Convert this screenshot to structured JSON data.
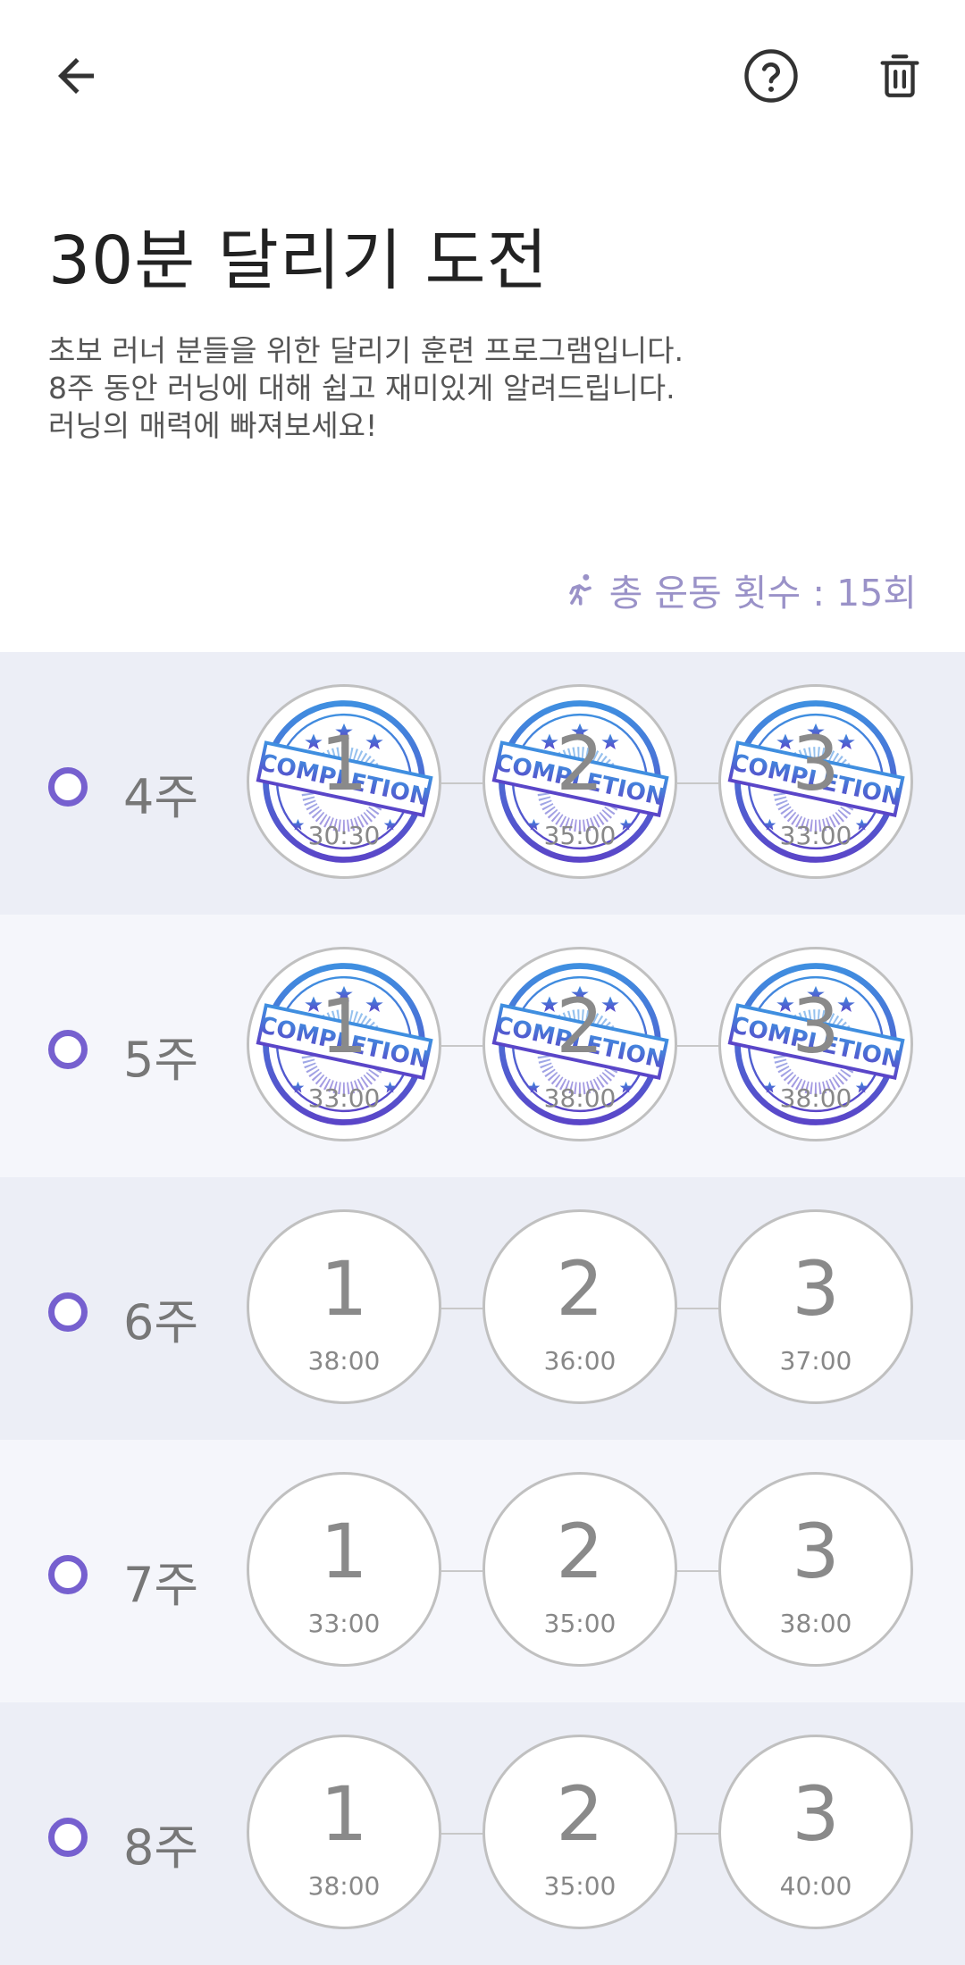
{
  "header": {
    "back_icon": "arrow-left-icon",
    "help_icon": "question-circle-icon",
    "delete_icon": "trash-icon"
  },
  "program": {
    "title": "30분 달리기 도전",
    "description": [
      "초보 러너 분들을 위한 달리기 훈련 프로그램입니다.",
      "8주 동안 러닝에 대해 쉽고 재미있게 알려드립니다.",
      "러닝의 매력에 빠져보세요!"
    ],
    "total_label": "총 운동 횟수 : 15회",
    "total_icon": "running-icon"
  },
  "colors": {
    "accent": "#7660cf",
    "stamp_blue": "#3f6fd6",
    "stamp_purple": "#5a45c8"
  },
  "stamp_text": "COMPLETION",
  "weeks": [
    {
      "label": "4주",
      "completed": true,
      "sessions": [
        {
          "num": "1",
          "time": "30:30"
        },
        {
          "num": "2",
          "time": "35:00"
        },
        {
          "num": "3",
          "time": "33:00"
        }
      ]
    },
    {
      "label": "5주",
      "completed": true,
      "sessions": [
        {
          "num": "1",
          "time": "33:00"
        },
        {
          "num": "2",
          "time": "38:00"
        },
        {
          "num": "3",
          "time": "38:00"
        }
      ]
    },
    {
      "label": "6주",
      "completed": false,
      "sessions": [
        {
          "num": "1",
          "time": "38:00"
        },
        {
          "num": "2",
          "time": "36:00"
        },
        {
          "num": "3",
          "time": "37:00"
        }
      ]
    },
    {
      "label": "7주",
      "completed": false,
      "sessions": [
        {
          "num": "1",
          "time": "33:00"
        },
        {
          "num": "2",
          "time": "35:00"
        },
        {
          "num": "3",
          "time": "38:00"
        }
      ]
    },
    {
      "label": "8주",
      "completed": false,
      "sessions": [
        {
          "num": "1",
          "time": "38:00"
        },
        {
          "num": "2",
          "time": "35:00"
        },
        {
          "num": "3",
          "time": "40:00"
        }
      ]
    }
  ]
}
